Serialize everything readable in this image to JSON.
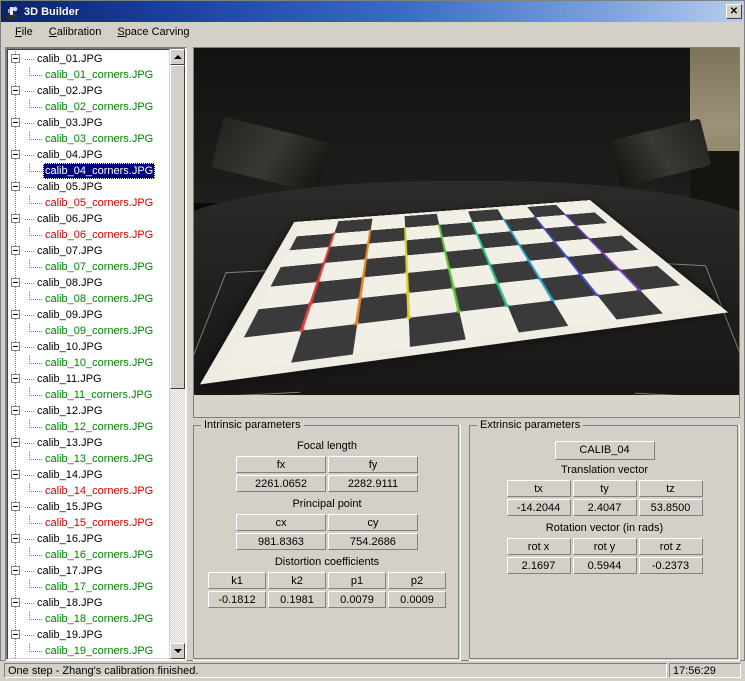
{
  "window": {
    "title": "3D Builder",
    "icon": "app-icon",
    "close_label": "✕"
  },
  "menubar": {
    "items": [
      {
        "label": "File",
        "accel": "F"
      },
      {
        "label": "Calibration",
        "accel": "C"
      },
      {
        "label": "Space Carving",
        "accel": "S"
      }
    ]
  },
  "tree": {
    "nodes": [
      {
        "parent": "calib_01.JPG",
        "child": "calib_01_corners.JPG",
        "status": "ok"
      },
      {
        "parent": "calib_02.JPG",
        "child": "calib_02_corners.JPG",
        "status": "ok"
      },
      {
        "parent": "calib_03.JPG",
        "child": "calib_03_corners.JPG",
        "status": "ok"
      },
      {
        "parent": "calib_04.JPG",
        "child": "calib_04_corners.JPG",
        "status": "selected"
      },
      {
        "parent": "calib_05.JPG",
        "child": "calib_05_corners.JPG",
        "status": "bad"
      },
      {
        "parent": "calib_06.JPG",
        "child": "calib_06_corners.JPG",
        "status": "bad"
      },
      {
        "parent": "calib_07.JPG",
        "child": "calib_07_corners.JPG",
        "status": "ok"
      },
      {
        "parent": "calib_08.JPG",
        "child": "calib_08_corners.JPG",
        "status": "ok"
      },
      {
        "parent": "calib_09.JPG",
        "child": "calib_09_corners.JPG",
        "status": "ok"
      },
      {
        "parent": "calib_10.JPG",
        "child": "calib_10_corners.JPG",
        "status": "ok"
      },
      {
        "parent": "calib_11.JPG",
        "child": "calib_11_corners.JPG",
        "status": "ok"
      },
      {
        "parent": "calib_12.JPG",
        "child": "calib_12_corners.JPG",
        "status": "ok"
      },
      {
        "parent": "calib_13.JPG",
        "child": "calib_13_corners.JPG",
        "status": "ok"
      },
      {
        "parent": "calib_14.JPG",
        "child": "calib_14_corners.JPG",
        "status": "bad"
      },
      {
        "parent": "calib_15.JPG",
        "child": "calib_15_corners.JPG",
        "status": "bad"
      },
      {
        "parent": "calib_16.JPG",
        "child": "calib_16_corners.JPG",
        "status": "ok"
      },
      {
        "parent": "calib_17.JPG",
        "child": "calib_17_corners.JPG",
        "status": "ok"
      },
      {
        "parent": "calib_18.JPG",
        "child": "calib_18_corners.JPG",
        "status": "ok"
      },
      {
        "parent": "calib_19.JPG",
        "child": "calib_19_corners.JPG",
        "status": "ok"
      }
    ],
    "expander_glyph": "-",
    "colors": {
      "ok": "#008000",
      "bad": "#cc0000",
      "selected_bg": "#000080",
      "selected_fg": "#ffffff"
    }
  },
  "viewer": {
    "image_name": "calib_04_corners.JPG",
    "description": "Checkerboard calibration target photographed on a dark turntable with detected corner polylines overlaid"
  },
  "intrinsic": {
    "group_title": "Intrinsic parameters",
    "focal": {
      "title": "Focal length",
      "headers": [
        "fx",
        "fy"
      ],
      "values": [
        "2261.0652",
        "2282.9111"
      ]
    },
    "principal": {
      "title": "Principal point",
      "headers": [
        "cx",
        "cy"
      ],
      "values": [
        "981.8363",
        "754.2686"
      ]
    },
    "distortion": {
      "title": "Distortion coefficients",
      "headers": [
        "k1",
        "k2",
        "p1",
        "p2"
      ],
      "values": [
        "-0.1812",
        "0.1981",
        "0.0079",
        "0.0009"
      ]
    }
  },
  "extrinsic": {
    "group_title": "Extrinsic parameters",
    "calib_name": "CALIB_04",
    "translation": {
      "title": "Translation vector",
      "headers": [
        "tx",
        "ty",
        "tz"
      ],
      "values": [
        "-14.2044",
        "2.4047",
        "53.8500"
      ]
    },
    "rotation": {
      "title": "Rotation vector (in rads)",
      "headers": [
        "rot x",
        "rot y",
        "rot z"
      ],
      "values": [
        "2.1697",
        "0.5944",
        "-0.2373"
      ]
    }
  },
  "statusbar": {
    "message": "One step - Zhang's calibration finished.",
    "time": "17:56:29"
  }
}
